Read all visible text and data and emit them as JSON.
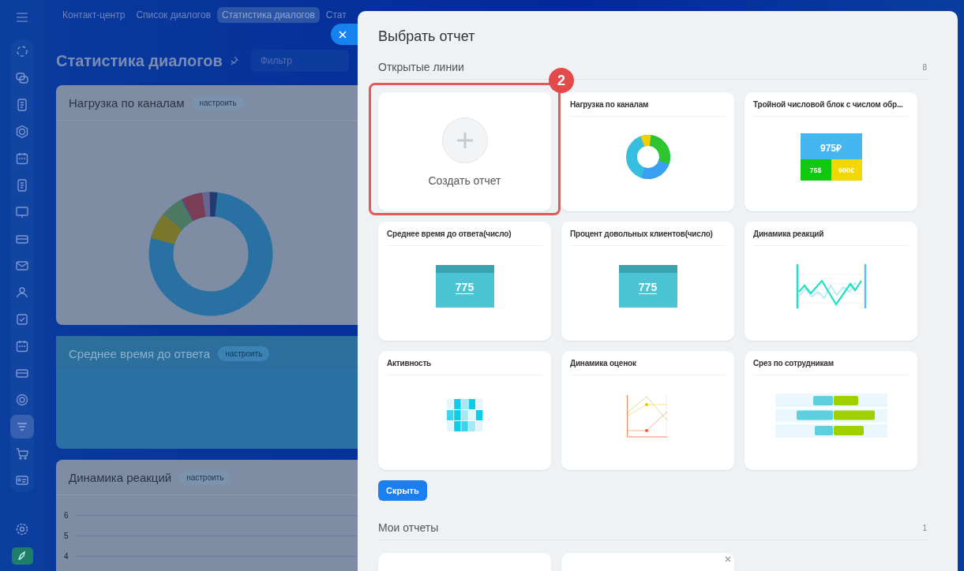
{
  "sidebar": {
    "items": [
      {
        "selected": false
      },
      {
        "selected": false
      },
      {
        "selected": false
      },
      {
        "selected": false
      },
      {
        "selected": false
      },
      {
        "selected": false
      },
      {
        "selected": false
      },
      {
        "selected": false
      },
      {
        "selected": false
      },
      {
        "selected": false
      },
      {
        "selected": false
      },
      {
        "selected": false
      },
      {
        "selected": false
      },
      {
        "selected": false
      },
      {
        "selected": true
      },
      {
        "selected": false
      },
      {
        "selected": false
      }
    ]
  },
  "top_nav": {
    "tabs": [
      {
        "label": "Контакт-центр",
        "selected": false
      },
      {
        "label": "Список диалогов",
        "selected": false
      },
      {
        "label": "Статистика диалогов",
        "selected": true
      },
      {
        "label": "Стат",
        "selected": false
      }
    ]
  },
  "page": {
    "title": "Статистика диалогов",
    "filter": {
      "placeholder": "Фильтр"
    },
    "widgets": [
      {
        "kind": "donut",
        "title": "Нагрузка по каналам",
        "button": "настроить"
      },
      {
        "kind": "number",
        "title": "Среднее время до ответа",
        "button": "настроить"
      },
      {
        "kind": "line",
        "title": "Динамика реакций",
        "button": "настроить",
        "y_ticks": [
          "6",
          "5",
          "4"
        ]
      }
    ]
  },
  "panel": {
    "title": "Выбрать отчет",
    "sections": [
      {
        "title": "Открытые линии",
        "count": "8",
        "cards": [
          {
            "kind": "create",
            "title": "Создать отчет",
            "highlighted": true,
            "step": "2"
          },
          {
            "kind": "donut",
            "title": "Нагрузка по каналам"
          },
          {
            "kind": "triple",
            "title": "Тройной числовой блок с числом обр...",
            "preview_values": [
              "975₽",
              "75$",
              "900€"
            ]
          },
          {
            "kind": "number",
            "title": "Среднее время до ответа(число)",
            "preview_values": [
              "775"
            ]
          },
          {
            "kind": "number",
            "title": "Процент довольных клиентов(число)",
            "preview_values": [
              "775"
            ]
          },
          {
            "kind": "line",
            "title": "Динамика реакций"
          },
          {
            "kind": "heatmap",
            "title": "Активность"
          },
          {
            "kind": "scoreline",
            "title": "Динамика оценок"
          },
          {
            "kind": "bars",
            "title": "Срез по сотрудникам"
          }
        ],
        "button": "Скрыть"
      },
      {
        "title": "Мои отчеты",
        "count": "1",
        "cards": [
          {
            "kind": "partial",
            "closable": false
          },
          {
            "kind": "partial",
            "closable": true
          }
        ]
      }
    ]
  }
}
